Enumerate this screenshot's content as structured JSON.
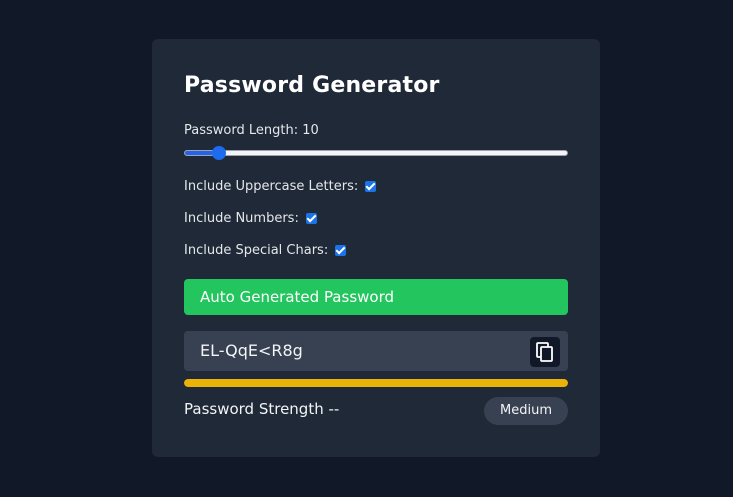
{
  "title": "Password Generator",
  "length": {
    "label": "Password Length: 10",
    "value": 10,
    "min": 6,
    "max": 64,
    "fill_fraction": 0.09
  },
  "options": [
    {
      "label": "Include Uppercase Letters:",
      "checked": true
    },
    {
      "label": "Include Numbers:",
      "checked": true
    },
    {
      "label": "Include Special Chars:",
      "checked": true
    }
  ],
  "generate_label": "Auto Generated Password",
  "password": "EL-QqE<R8g",
  "copy_icon": "copy-icon",
  "strength": {
    "label": "Password Strength --",
    "badge": "Medium",
    "fraction": 1.0,
    "color": "#eab308"
  },
  "colors": {
    "accent_green": "#22c55e",
    "slider_blue": "#1d6cf0",
    "strength_yellow": "#eab308",
    "card_bg": "#1f2937",
    "page_bg": "#111827"
  }
}
